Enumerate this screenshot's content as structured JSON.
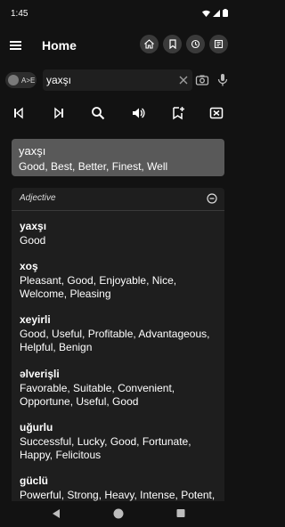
{
  "status_bar": {
    "time": "1:45"
  },
  "app_bar": {
    "title": "Home"
  },
  "search": {
    "toggle_label": "A>E",
    "query": "yaxşı"
  },
  "result": {
    "word": "yaxşı",
    "meanings": "Good, Best, Better, Finest, Well"
  },
  "section": {
    "part_of_speech": "Adjective",
    "entries": [
      {
        "word": "yaxşı",
        "meanings": "Good"
      },
      {
        "word": "xoş",
        "meanings": "Pleasant, Good, Enjoyable, Nice, Welcome, Pleasing"
      },
      {
        "word": "xeyirli",
        "meanings": "Good, Useful, Profitable, Advantageous, Helpful, Benign"
      },
      {
        "word": "əlverişli",
        "meanings": "Favorable, Suitable, Convenient, Opportune, Useful, Good"
      },
      {
        "word": "uğurlu",
        "meanings": "Successful, Lucky, Good, Fortunate, Happy, Felicitous"
      },
      {
        "word": "güclü",
        "meanings": "Powerful, Strong, Heavy, Intense, Potent,"
      }
    ]
  },
  "icons": {
    "app_bar": [
      "menu-icon",
      "home-icon",
      "bookmark-icon",
      "history-icon",
      "flashcard-icon"
    ],
    "toolbar": [
      "skip-previous-icon",
      "skip-next-icon",
      "search-icon",
      "volume-icon",
      "bookmark-add-icon",
      "clear-icon"
    ]
  },
  "colors": {
    "background": "#121212",
    "result_card": "#595959",
    "entry_card": "#1e1e1e",
    "circle_button": "#3a3a3a"
  }
}
